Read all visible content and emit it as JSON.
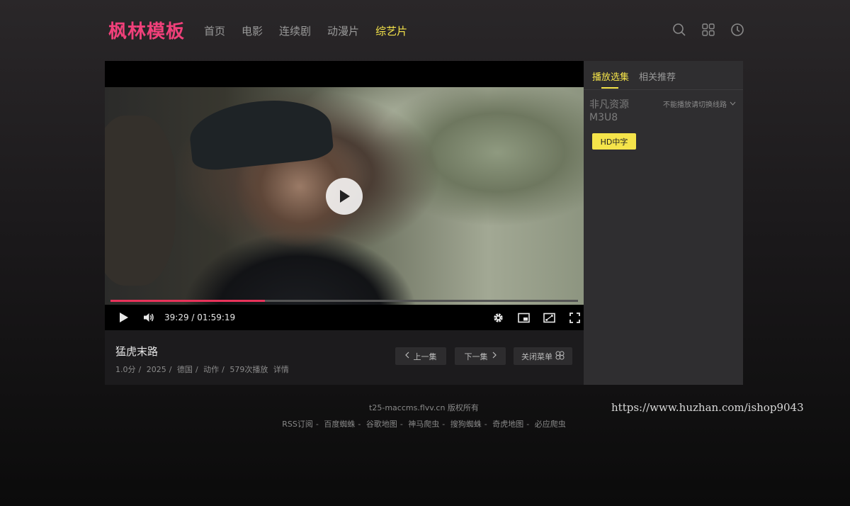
{
  "header": {
    "logo": "枫林模板",
    "nav": [
      {
        "label": "首页",
        "active": false
      },
      {
        "label": "电影",
        "active": false
      },
      {
        "label": "连续剧",
        "active": false
      },
      {
        "label": "动漫片",
        "active": false
      },
      {
        "label": "综艺片",
        "active": true
      }
    ],
    "icons": [
      "search-icon",
      "grid-icon",
      "history-icon"
    ]
  },
  "player": {
    "current_time": "39:29",
    "duration": "01:59:19",
    "time_display": "39:29 / 01:59:19",
    "progress_fraction": 0.331,
    "controls": [
      "play-icon",
      "volume-icon",
      "settings-icon",
      "pip-icon",
      "widescreen-icon",
      "fullscreen-icon"
    ],
    "accent_color": "#e8335a"
  },
  "info": {
    "title": "猛虎末路",
    "meta": {
      "score": "1.0分",
      "year": "2025",
      "region": "德国",
      "genre": "动作",
      "plays": "579次播放",
      "detail_link": "详情"
    },
    "prev_label": "上一集",
    "next_label": "下一集",
    "close_menu_label": "关闭菜单"
  },
  "side": {
    "tabs": [
      {
        "label": "播放选集",
        "active": true
      },
      {
        "label": "相关推荐",
        "active": false
      }
    ],
    "source_name": "非凡资源M3U8",
    "switch_hint": "不能播放请切换线路",
    "episodes": [
      {
        "label": "HD中字",
        "active": true
      }
    ],
    "accent_color": "#f5e44a"
  },
  "footer": {
    "copyright": "t25-maccms.flvv.cn 版权所有",
    "links": [
      "RSS订阅",
      "百度蜘蛛",
      "谷歌地图",
      "神马爬虫",
      "搜狗蜘蛛",
      "奇虎地图",
      "必应爬虫"
    ],
    "separator": "-"
  },
  "watermark": "https://www.huzhan.com/ishop9043"
}
